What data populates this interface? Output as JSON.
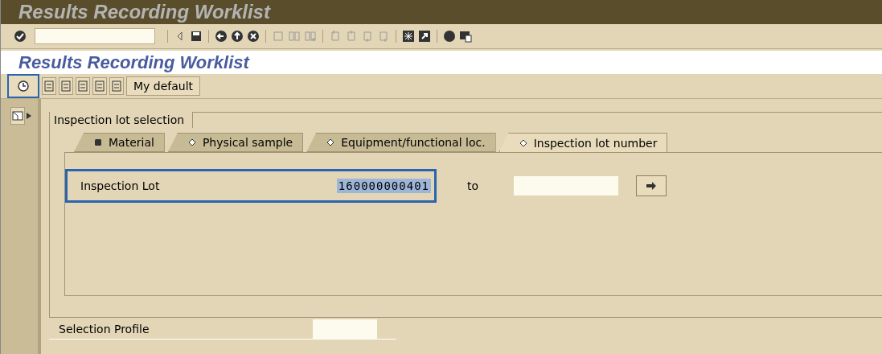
{
  "window": {
    "title": "Results Recording Worklist"
  },
  "screen_title": "Results Recording Worklist",
  "app_toolbar": {
    "execute_highlighted": true,
    "variant_button": "My default"
  },
  "selection": {
    "group_title": "Inspection lot selection",
    "tabs": [
      {
        "label": "Material",
        "selected": false,
        "has_entries": true
      },
      {
        "label": "Physical sample",
        "selected": false,
        "has_entries": false
      },
      {
        "label": "Equipment/functional loc.",
        "selected": false,
        "has_entries": false
      },
      {
        "label": "Inspection lot number",
        "selected": true,
        "has_entries": false
      }
    ],
    "field": {
      "label": "Inspection Lot",
      "value": "160000000401",
      "value_selected": true,
      "highlighted": true,
      "to_label": "to"
    }
  },
  "selection_profile": {
    "label": "Selection Profile"
  }
}
